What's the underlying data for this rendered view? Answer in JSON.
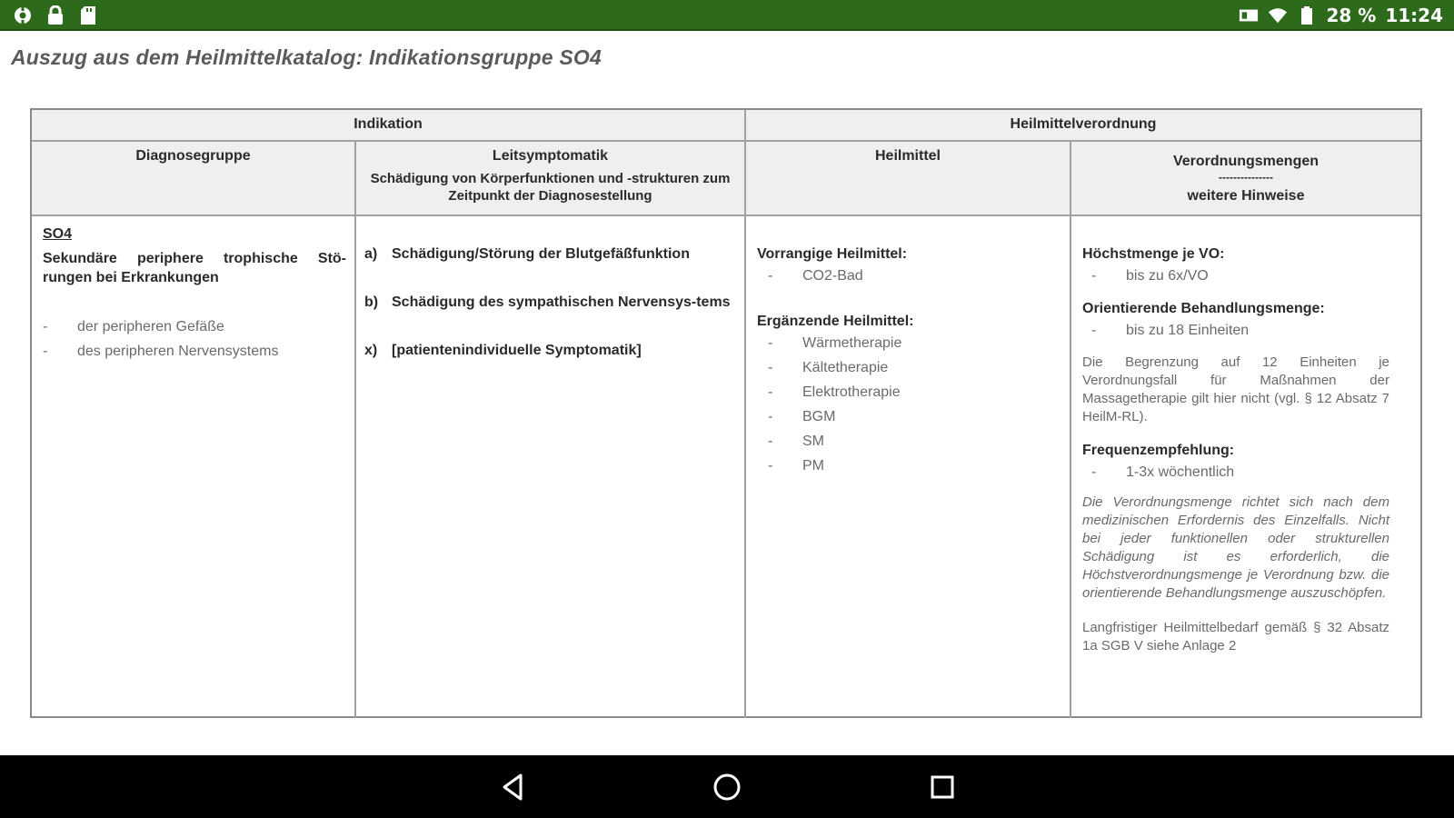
{
  "status_bar": {
    "left_icons": [
      "settings-icon",
      "lock-icon",
      "sd-card-icon"
    ],
    "right_icons": [
      "sim-icon",
      "wifi-icon",
      "battery-icon"
    ],
    "battery": "28 %",
    "time": "11:24"
  },
  "page": {
    "title": "Auszug aus dem Heilmittelkatalog: Indikationsgruppe SO4"
  },
  "table": {
    "header_groups": {
      "indikation": "Indikation",
      "heilmittelverordnung": "Heilmittelverordnung"
    },
    "columns": {
      "diagnosegruppe": "Diagnosegruppe",
      "leitsymptomatik": "Leitsymptomatik",
      "leitsymptomatik_sub": "Schädigung von Körperfunktionen und -strukturen zum Zeitpunkt der Diagnosestellung",
      "heilmittel": "Heilmittel",
      "verordnungsmengen": "Verordnungsmengen",
      "verordnungsmengen_sep": "---------------",
      "weitere_hinweise": "weitere Hinweise"
    },
    "diagnose": {
      "code": "SO4",
      "title": "Sekundäre periphere trophische Stö-rungen bei Erkrankungen",
      "items": [
        "der peripheren Gefäße",
        "des peripheren Nervensystems"
      ]
    },
    "leitsymptomatik": [
      {
        "label": "a)",
        "text": "Schädigung/Störung der Blutgefäßfunktion"
      },
      {
        "label": "b)",
        "text": "Schädigung des sympathischen Nervensys-tems"
      },
      {
        "label": "x)",
        "text": "[patientenindividuelle Symptomatik]"
      }
    ],
    "heilmittel": {
      "vorrangig_title": "Vorrangige Heilmittel:",
      "vorrangig": [
        "CO2-Bad"
      ],
      "ergaenzend_title": "Ergänzende Heilmittel:",
      "ergaenzend": [
        "Wärmetherapie",
        "Kältetherapie",
        "Elektrotherapie",
        "BGM",
        "SM",
        "PM"
      ]
    },
    "verordnung": {
      "hoechstmenge_title": "Höchstmenge je VO:",
      "hoechstmenge": "bis zu 6x/VO",
      "orientierend_title": "Orientierende Behandlungsmenge:",
      "orientierend": "bis zu 18 Einheiten",
      "begrenzung": "Die Begrenzung auf 12 Einheiten je Verordnungsfall für Maßnahmen der Massagetherapie gilt hier nicht (vgl. § 12 Absatz 7 HeilM-RL).",
      "frequenz_title": "Frequenzempfehlung:",
      "frequenz": "1-3x wöchentlich",
      "hinweis": "Die Verordnungsmenge richtet sich nach dem medizinischen Erfordernis des Einzelfalls. Nicht bei jeder funktionellen oder strukturellen Schädigung ist es erforderlich, die Höchstverordnungsmenge je Verordnung bzw. die orientierende Behandlungsmenge auszuschöpfen.",
      "langfristig": "Langfristiger Heilmittelbedarf gemäß § 32 Absatz 1a SGB V siehe Anlage 2"
    }
  },
  "nav_bar": {
    "buttons": [
      "back-icon",
      "home-icon",
      "recents-icon"
    ]
  }
}
